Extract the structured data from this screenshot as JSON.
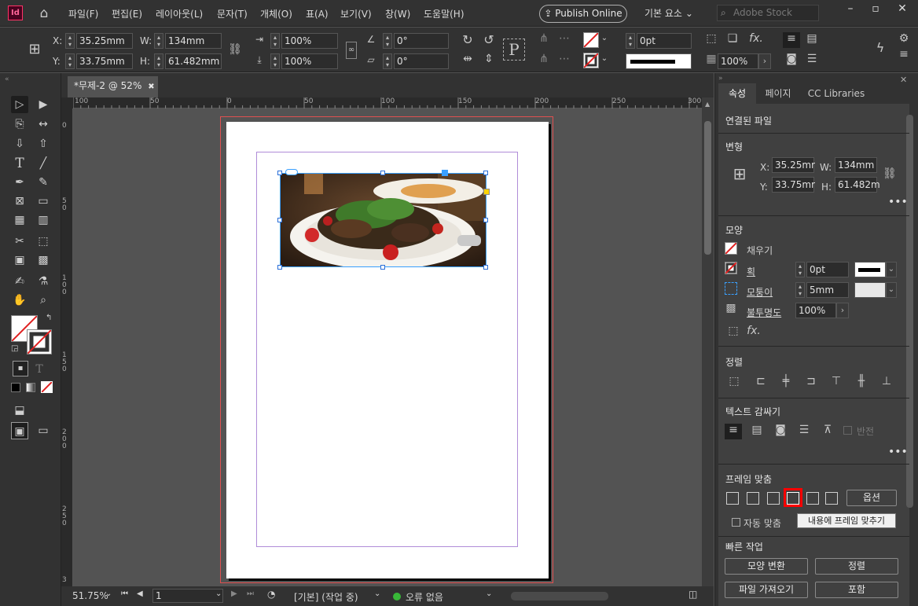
{
  "app": {
    "icon_label": "Id"
  },
  "menu": [
    "파일(F)",
    "편집(E)",
    "레이아웃(L)",
    "문자(T)",
    "개체(O)",
    "표(A)",
    "보기(V)",
    "창(W)",
    "도움말(H)"
  ],
  "header": {
    "publish_online": "Publish Online",
    "workspace": "기본 요소",
    "stock_placeholder": "Adobe Stock"
  },
  "control_bar": {
    "x_label": "X:",
    "x_value": "35.25mm",
    "y_label": "Y:",
    "y_value": "33.75mm",
    "w_label": "W:",
    "w_value": "134mm",
    "h_label": "H:",
    "h_value": "61.482mm",
    "scale_x": "100%",
    "scale_y": "100%",
    "rotate": "0°",
    "shear": "0°",
    "stroke_weight": "0pt",
    "opacity": "100%"
  },
  "document_tab": {
    "label": "*무제-2 @ 52%",
    "close": "✖"
  },
  "ruler": {
    "h_ticks": [
      "100",
      "50",
      "0",
      "50",
      "100",
      "150",
      "200",
      "250",
      "300"
    ],
    "v_ticks": [
      "0",
      "5 0",
      "1 0 0",
      "1 5 0",
      "2 0 0",
      "2 5 0",
      "3"
    ]
  },
  "status": {
    "zoom": "51.75%",
    "page": "1",
    "style": "[기본] (작업 중)",
    "errors": "오류 없음"
  },
  "panel": {
    "tabs": [
      "속성",
      "페이지",
      "CC Libraries"
    ],
    "linked_file": "연결된 파일",
    "transform": {
      "title": "변형",
      "x_label": "X:",
      "x": "35.25mr",
      "y_label": "Y:",
      "y": "33.75mr",
      "w_label": "W:",
      "w": "134mm",
      "h_label": "H:",
      "h": "61.482m"
    },
    "appearance": {
      "title": "모양",
      "fill": "채우기",
      "stroke": "획",
      "stroke_value": "0pt",
      "corner": "모퉁이",
      "corner_value": "5mm",
      "opacity": "불투명도",
      "opacity_value": "100%"
    },
    "align": {
      "title": "정렬"
    },
    "text_wrap": {
      "title": "텍스트 감싸기",
      "invert": "반전"
    },
    "frame_fit": {
      "title": "프레임 맞춤",
      "options": "옵션",
      "auto_fit": "자동 맞춤",
      "tooltip": "내용에 프레임 맞추기"
    },
    "quick_actions": {
      "title": "빠른 작업",
      "buttons": [
        "모양 변환",
        "정렬",
        "파일 가져오기",
        "포함"
      ]
    }
  },
  "colors": {
    "accent": "#3aa0ff",
    "highlight": "#ff0000",
    "bleed": "#e05050",
    "margin": "#b08cd8"
  }
}
